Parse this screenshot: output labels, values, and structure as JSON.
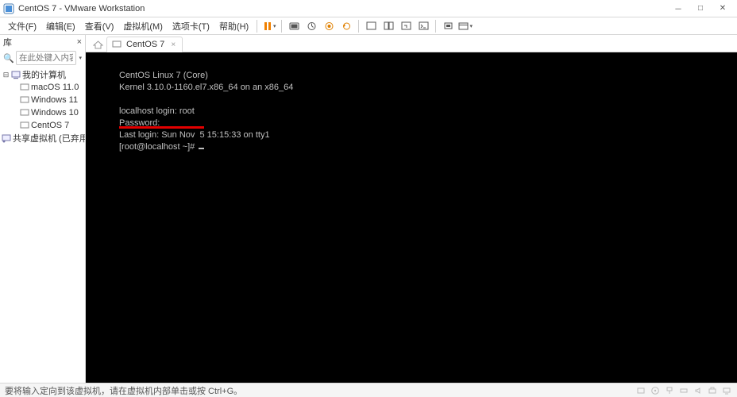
{
  "title": "CentOS 7 - VMware Workstation",
  "menu": {
    "file": "文件(F)",
    "edit": "编辑(E)",
    "view": "查看(V)",
    "vm": "虚拟机(M)",
    "tabs": "选项卡(T)",
    "help": "帮助(H)"
  },
  "sidebar": {
    "header": "库",
    "search_placeholder": "在此处键入内容进行搜索",
    "root": "我的计算机",
    "items": [
      {
        "label": "macOS 11.0"
      },
      {
        "label": "Windows 11"
      },
      {
        "label": "Windows 10"
      },
      {
        "label": "CentOS 7"
      }
    ],
    "shared": "共享虚拟机 (已弃用)"
  },
  "tab": {
    "label": "CentOS 7"
  },
  "console": {
    "l1": "CentOS Linux 7 (Core)",
    "l2": "Kernel 3.10.0-1160.el7.x86_64 on an x86_64",
    "blank": "",
    "l3": "localhost login: root",
    "l4": "Password:",
    "l5": "Last login: Sun Nov  5 15:15:33 on tty1",
    "l6": "[root@localhost ~]# "
  },
  "statusbar": {
    "text": "要将输入定向到该虚拟机，请在虚拟机内部单击或按 Ctrl+G。"
  }
}
